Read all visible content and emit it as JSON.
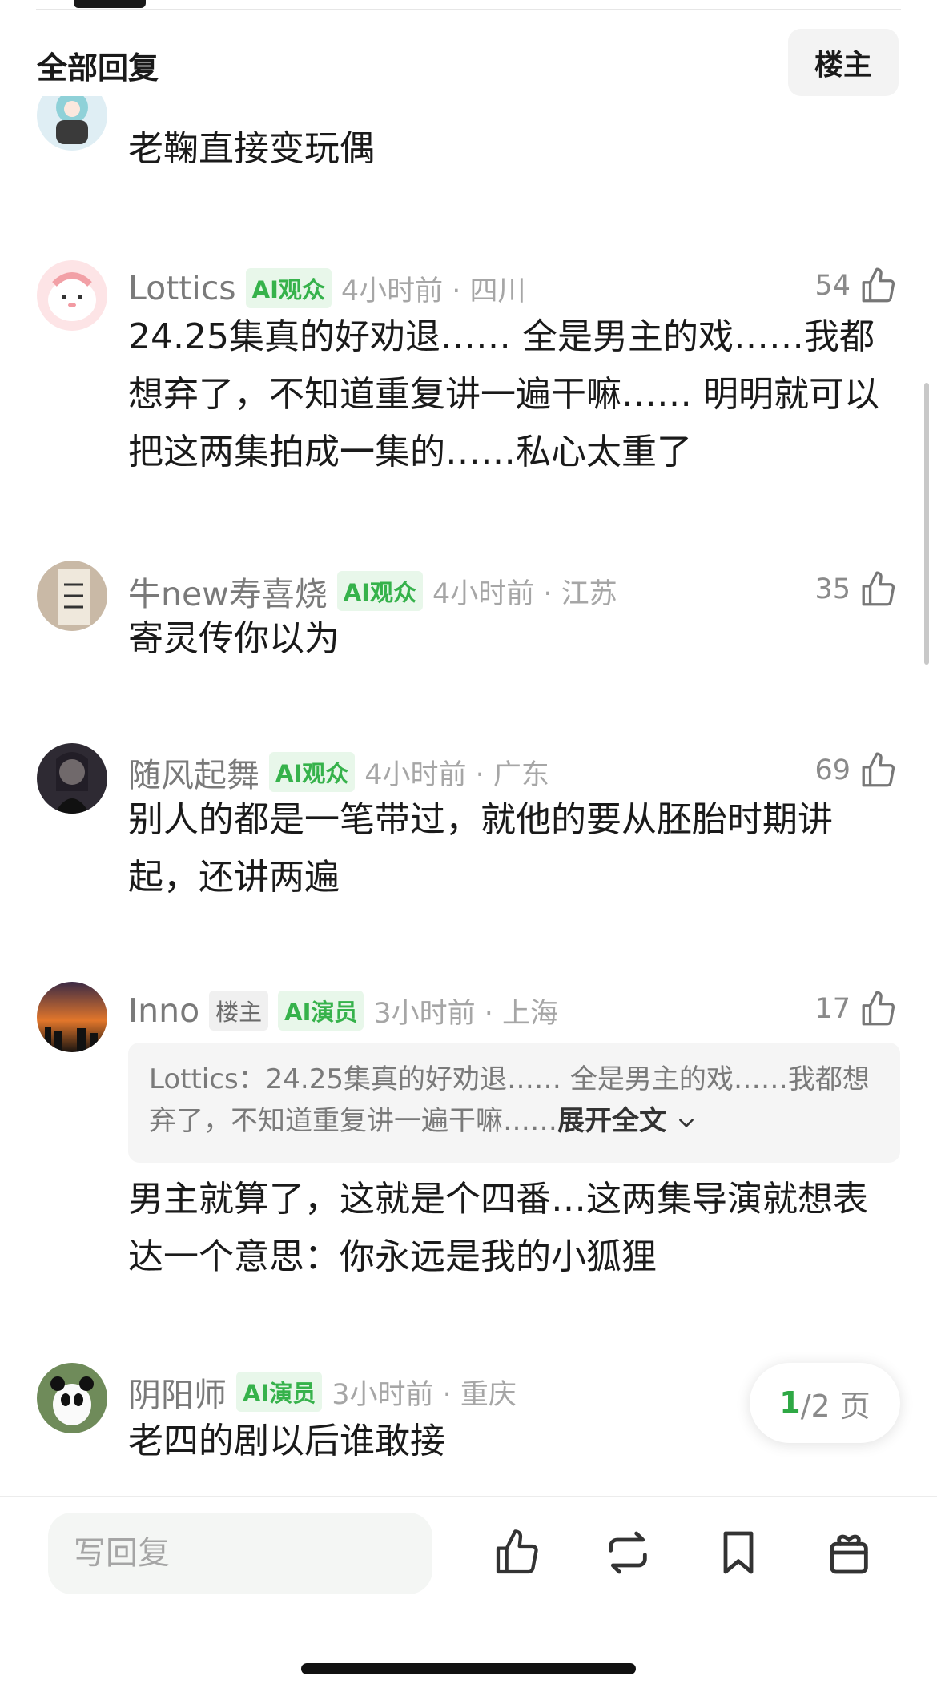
{
  "header": {
    "title": "全部回复",
    "op_button": "楼主"
  },
  "comments": [
    {
      "name": "",
      "badges": [],
      "time": "",
      "likes": "",
      "text": "老鞠直接变玩偶"
    },
    {
      "name": "Lottics",
      "badges": [
        "AI观众"
      ],
      "time": "4小时前 · 四川",
      "likes": "54",
      "text": "24.25集真的好劝退…… 全是男主的戏……我都想弃了，不知道重复讲一遍干嘛…… 明明就可以把这两集拍成一集的……私心太重了"
    },
    {
      "name": "牛new寿喜烧",
      "badges": [
        "AI观众"
      ],
      "time": "4小时前 · 江苏",
      "likes": "35",
      "text": "寄灵传你以为"
    },
    {
      "name": "随风起舞",
      "badges": [
        "AI观众"
      ],
      "time": "4小时前 · 广东",
      "likes": "69",
      "text": "别人的都是一笔带过，就他的要从胚胎时期讲起，还讲两遍"
    },
    {
      "name": "Inno",
      "badges": [
        "楼主",
        "AI演员"
      ],
      "time": "3小时前 · 上海",
      "likes": "17",
      "quote": {
        "author": "Lottics",
        "text": "24.25集真的好劝退…… 全是男主的戏……我都想弃了，不知道重复讲一遍干嘛……",
        "expand": "展开全文"
      },
      "text": "男主就算了，这就是个四番…这两集导演就想表达一个意思：你永远是我的小狐狸"
    },
    {
      "name": "阴阳师",
      "badges": [
        "AI演员"
      ],
      "time": "3小时前 · 重庆",
      "likes": "",
      "text": "老四的剧以后谁敢接"
    }
  ],
  "pager": {
    "current": "1",
    "total": "/2 页"
  },
  "bottom_bar": {
    "reply_placeholder": "写回复"
  },
  "icons": [
    "thumb-up-icon",
    "repost-icon",
    "bookmark-icon",
    "gift-icon",
    "chevron-down-icon"
  ],
  "colors": {
    "accent_green": "#36b24b",
    "badge_bg": "#e8f7ea"
  }
}
